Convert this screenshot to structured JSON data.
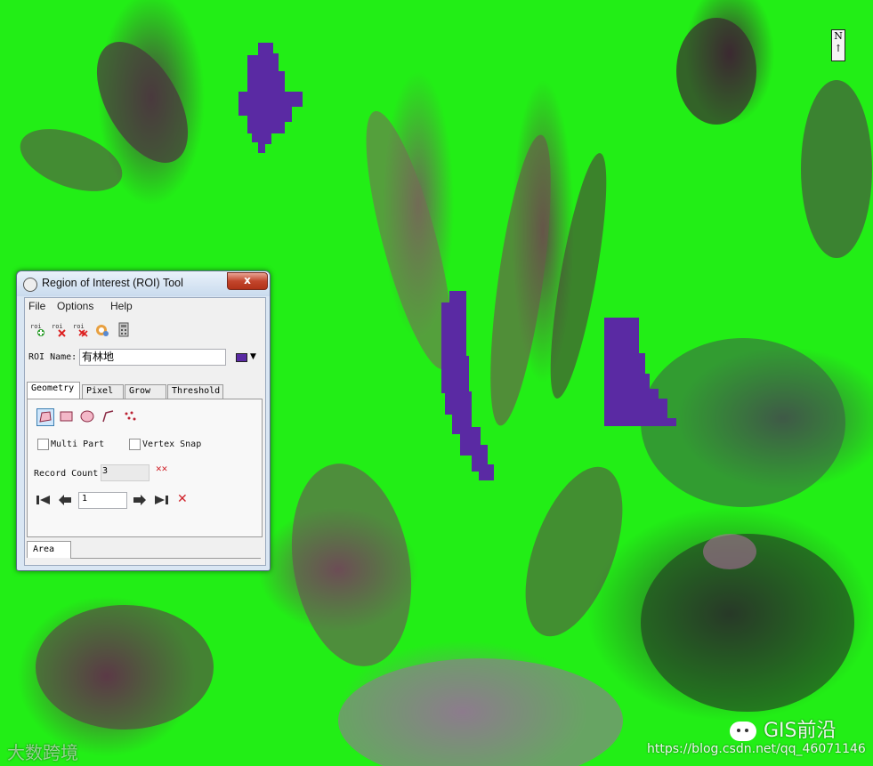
{
  "window": {
    "title": "Region of Interest (ROI) Tool",
    "close_symbol": "x"
  },
  "menu": [
    "File",
    "Options",
    "Help"
  ],
  "toolbar": {
    "icons": [
      "new-roi-icon",
      "delete-roi-icon",
      "delete-all-roi-icon",
      "roi-options-icon",
      "statistics-icon"
    ],
    "icon_text": "roi"
  },
  "roi": {
    "name_label": "ROI Name:",
    "name_value": "有林地",
    "color": "#5a2aa3",
    "dropdown_symbol": "▼"
  },
  "tabs": [
    "Geometry",
    "Pixel",
    "Grow",
    "Threshold"
  ],
  "geometry": {
    "tools": [
      "polygon-icon",
      "rectangle-icon",
      "ellipse-icon",
      "polyline-icon",
      "point-icon"
    ],
    "multi_part_label": "Multi Part",
    "vertex_snap_label": "Vertex Snap",
    "record_count_label": "Record Count",
    "record_count_value": "3",
    "current_record": "1",
    "nav_symbols": {
      "first": "⏮",
      "prev": "🡐",
      "next": "🡒",
      "last": "⏭",
      "delete": "✕",
      "delete_all": "✕✕"
    }
  },
  "bottom_tab": "Area",
  "map": {
    "north_label": "N",
    "vegetation_color": "#22ee16",
    "roi_color": "#5a2aa3"
  },
  "watermarks": {
    "left": "大数跨境",
    "brand": "GIS前沿",
    "url": "https://blog.csdn.net/qq_46071146"
  }
}
